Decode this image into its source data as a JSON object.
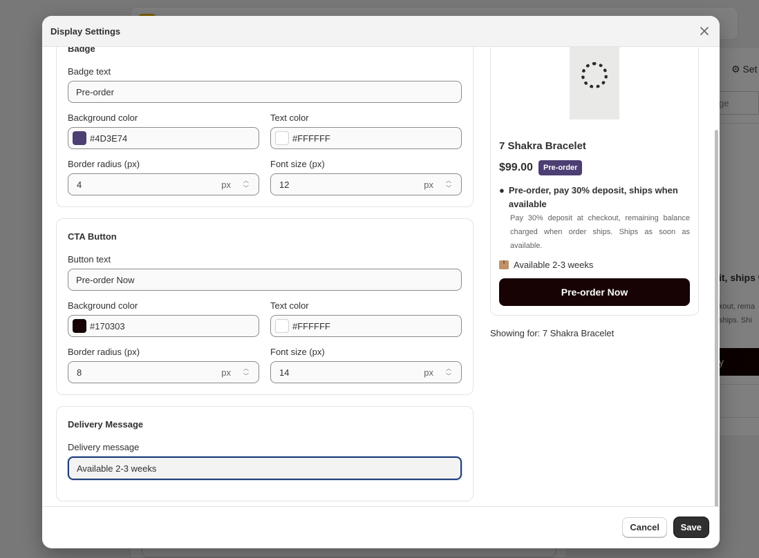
{
  "background": {
    "settings_label": "Set",
    "input_partial": "ge",
    "text_partial": "it, ships w",
    "desc_partial_1": "kout, rema",
    "desc_partial_2": "ships. Shi",
    "button_partial": "y"
  },
  "modal": {
    "title": "Display Settings",
    "close_icon": "close-icon"
  },
  "badge_section": {
    "title": "Badge",
    "badge_text_label": "Badge text",
    "badge_text_value": "Pre-order",
    "bg_color_label": "Background color",
    "bg_color_value": "#4D3E74",
    "text_color_label": "Text color",
    "text_color_value": "#FFFFFF",
    "border_radius_label": "Border radius (px)",
    "border_radius_value": "4",
    "font_size_label": "Font size (px)",
    "font_size_value": "12",
    "unit": "px"
  },
  "cta_section": {
    "title": "CTA Button",
    "button_text_label": "Button text",
    "button_text_value": "Pre-order Now",
    "bg_color_label": "Background color",
    "bg_color_value": "#170303",
    "text_color_label": "Text color",
    "text_color_value": "#FFFFFF",
    "border_radius_label": "Border radius (px)",
    "border_radius_value": "8",
    "font_size_label": "Font size (px)",
    "font_size_value": "14",
    "unit": "px"
  },
  "delivery_section": {
    "title": "Delivery Message",
    "message_label": "Delivery message",
    "message_value": "Available 2-3 weeks"
  },
  "preview": {
    "product_title": "7 Shakra Bracelet",
    "price": "$99.00",
    "badge": "Pre-order",
    "message_title": "Pre-order, pay 30% deposit, ships when available",
    "message_desc": "Pay 30% deposit at checkout, remaining balance charged when order ships. Ships as soon as available.",
    "availability": "Available 2-3 weeks",
    "cta": "Pre-order Now",
    "showing_for": "Showing for: 7 Shakra Bracelet"
  },
  "footer": {
    "cancel": "Cancel",
    "save": "Save"
  },
  "colors": {
    "badge_bg": "#4D3E74",
    "cta_bg": "#170303",
    "text": "#FFFFFF"
  }
}
